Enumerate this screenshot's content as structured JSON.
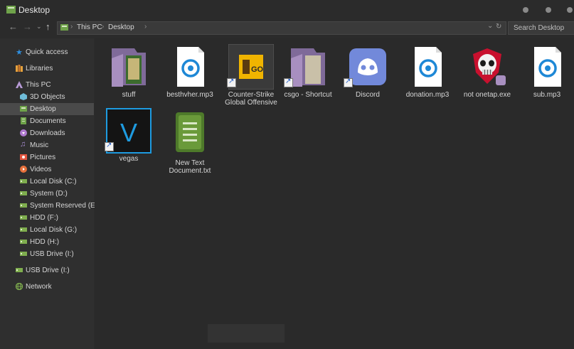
{
  "window": {
    "title": "Desktop"
  },
  "address": {
    "crumbs": [
      "This PC",
      "Desktop"
    ],
    "search_placeholder": "Search Desktop"
  },
  "sidebar": {
    "items": [
      {
        "label": "Quick access",
        "icon": "star-icon"
      },
      {
        "label": "Libraries",
        "icon": "libraries-icon"
      },
      {
        "label": "This PC",
        "icon": "this-pc-icon"
      },
      {
        "label": "3D Objects",
        "icon": "cube-icon"
      },
      {
        "label": "Desktop",
        "icon": "desktop-icon",
        "selected": true
      },
      {
        "label": "Documents",
        "icon": "documents-icon"
      },
      {
        "label": "Downloads",
        "icon": "download-icon"
      },
      {
        "label": "Music",
        "icon": "music-icon"
      },
      {
        "label": "Pictures",
        "icon": "pictures-icon"
      },
      {
        "label": "Videos",
        "icon": "videos-icon"
      },
      {
        "label": "Local Disk (C:)",
        "icon": "drive-icon"
      },
      {
        "label": "System (D:)",
        "icon": "drive-icon"
      },
      {
        "label": "System Reserved (E:)",
        "icon": "drive-icon"
      },
      {
        "label": "HDD (F:)",
        "icon": "drive-icon"
      },
      {
        "label": "Local Disk (G:)",
        "icon": "drive-icon"
      },
      {
        "label": "HDD (H:)",
        "icon": "drive-icon"
      },
      {
        "label": "USB Drive (I:)",
        "icon": "usb-drive-icon"
      },
      {
        "label": "USB Drive (I:)",
        "icon": "usb-drive-icon"
      },
      {
        "label": "Network",
        "icon": "network-icon"
      }
    ]
  },
  "files": [
    {
      "name": "stuff",
      "type": "folder"
    },
    {
      "name": "besthvher.mp3",
      "type": "audio"
    },
    {
      "name": "Counter-Strike Global Offensive",
      "type": "game",
      "shortcut": true
    },
    {
      "name": "csgo - Shortcut",
      "type": "folder",
      "shortcut": true
    },
    {
      "name": "Discord",
      "type": "discord",
      "shortcut": true
    },
    {
      "name": "donation.mp3",
      "type": "audio"
    },
    {
      "name": "not onetap.exe",
      "type": "exe"
    },
    {
      "name": "sub.mp3",
      "type": "audio"
    },
    {
      "name": "vegas",
      "type": "vegas",
      "shortcut": true,
      "selected": true
    },
    {
      "name": "New Text Document.txt",
      "type": "text"
    }
  ],
  "colors": {
    "folder": "#a88fc0",
    "audio_ring": "#1e88d6",
    "discord": "#7289da",
    "vegas_border": "#1e9be0",
    "textdoc": "#6a9a3a",
    "go_tag": "#f0b400"
  },
  "icon_text": {
    "go": "GO",
    "vegas": "V"
  }
}
